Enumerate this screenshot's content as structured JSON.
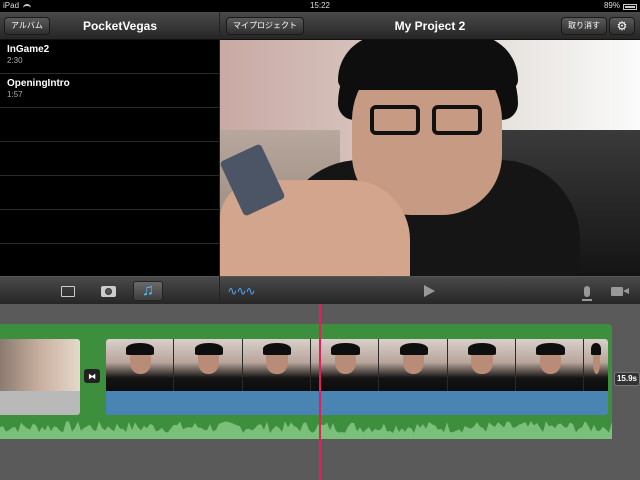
{
  "status_bar": {
    "device": "iPad",
    "time": "15:22",
    "battery": "89%"
  },
  "library": {
    "back_label": "アルバム",
    "title": "PocketVegas",
    "items": [
      {
        "name": "InGame2",
        "duration": "2:30"
      },
      {
        "name": "OpeningIntro",
        "duration": "1:57"
      }
    ]
  },
  "project": {
    "back_label": "マイプロジェクト",
    "title": "My Project 2",
    "undo_label": "取り消す"
  },
  "timeline": {
    "clip_duration": "15.9s"
  },
  "icons": {
    "video_tab": "video-icon",
    "photo_tab": "camera-icon",
    "audio_tab": "music-note-icon",
    "waveform": "waveform-icon",
    "play": "play-icon",
    "mic": "microphone-icon",
    "record": "video-camera-icon",
    "settings": "gear-icon"
  },
  "colors": {
    "accent": "#4fc1ff",
    "playhead": "#e0205a",
    "track": "#3d8f3d",
    "clip_audio": "#4a84b3"
  }
}
